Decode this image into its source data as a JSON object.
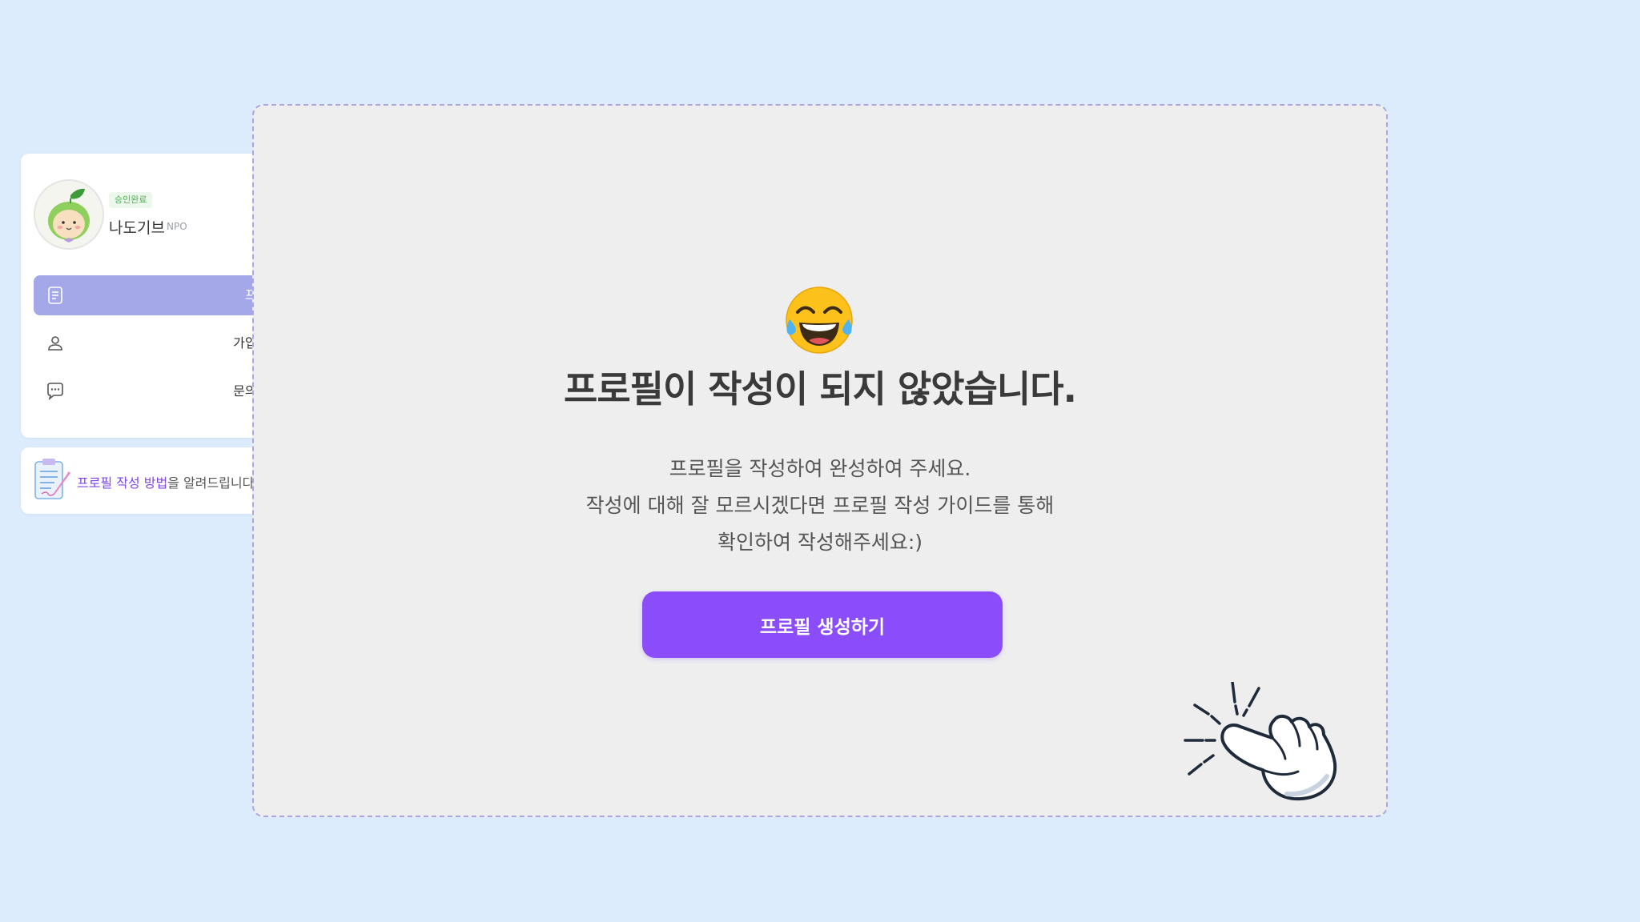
{
  "sidebar": {
    "profile": {
      "status_badge": "승인완료",
      "org_name": "나도기브",
      "org_type": "NPO"
    },
    "menu": [
      {
        "label": "프로필",
        "icon": "document-list-icon",
        "active": true
      },
      {
        "label": "가입정보",
        "icon": "person-icon",
        "active": false
      },
      {
        "label": "문의하기",
        "icon": "chat-bubble-icon",
        "active": false
      }
    ],
    "guide": {
      "highlight": "프로필 작성 방법",
      "text": "을 알려드립니다",
      "icon": "clipboard-pen-icon"
    }
  },
  "main": {
    "emoji": "face-with-tears-of-joy-icon",
    "title": "프로필이 작성이 되지 않았습니다.",
    "description": [
      "프로필을 작성하여 완성하여 주세요.",
      "작성에 대해 잘 모르시겠다면 프로필 작성 가이드를 통해",
      "확인하여 작성해주세요:)"
    ],
    "cta_label": "프로필 생성하기",
    "pointer": "click-hand-icon"
  },
  "colors": {
    "background": "#ddecfd",
    "panel": "#eeeeee",
    "panel_border": "#a9a6e0",
    "cta": "#8b4dfa",
    "menu_active": "#a4a8e8",
    "badge_text": "#49b04f",
    "guide_highlight": "#7d45e6"
  }
}
